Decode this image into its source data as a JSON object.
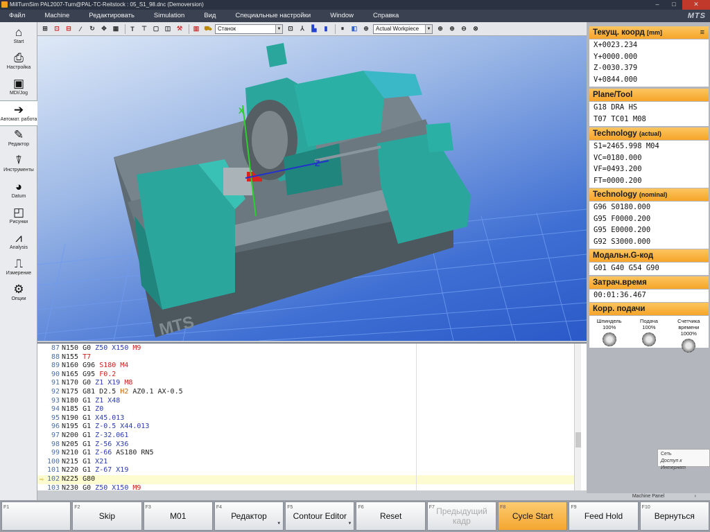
{
  "window": {
    "title": "MillTurnSim PAL2007-Turn@PAL-TC-Reitstock : 05_S1_98.dnc (Demoversion)"
  },
  "menu": {
    "items": [
      "Файл",
      "Machine",
      "Редактировать",
      "Simulation",
      "Вид",
      "Специальные настройки",
      "Window",
      "Справка"
    ],
    "brand": "MTS"
  },
  "sidebar": {
    "items": [
      {
        "label": "Start",
        "icon": "home-icon"
      },
      {
        "label": "Настройка",
        "icon": "setup-icon"
      },
      {
        "label": "MDI/Jog",
        "icon": "mdi-jog-icon"
      },
      {
        "label": "Автомат. работа",
        "icon": "auto-run-icon"
      },
      {
        "label": "Редактор",
        "icon": "editor-icon"
      },
      {
        "label": "Инструменты",
        "icon": "tools-icon"
      },
      {
        "label": "Datum",
        "icon": "datum-icon"
      },
      {
        "label": "Рисунки",
        "icon": "drawings-icon"
      },
      {
        "label": "Analysis",
        "icon": "analysis-icon"
      },
      {
        "label": "Измерение",
        "icon": "measure-icon"
      },
      {
        "label": "Опции",
        "icon": "options-icon"
      }
    ]
  },
  "toolbar": {
    "view_select": "Станок",
    "workpiece_select": "Actual Workpiece"
  },
  "viewport": {
    "watermark": "MTS",
    "axis_x": "X",
    "axis_z": "Z",
    "colors": {
      "machine": "#2aa69c",
      "bed": "#5d6a72",
      "grid": "#5f8ee6",
      "background": "#3f6fd3"
    }
  },
  "editor": {
    "current_line": 102,
    "lines": [
      {
        "n": "87",
        "tokens": [
          [
            "n",
            "N150 G0 "
          ],
          [
            "b",
            "Z50 X150 "
          ],
          [
            "r",
            "M9"
          ]
        ]
      },
      {
        "n": "88",
        "tokens": [
          [
            "n",
            "N155 "
          ],
          [
            "r",
            "T7"
          ]
        ]
      },
      {
        "n": "89",
        "tokens": [
          [
            "n",
            "N160 G96 "
          ],
          [
            "r",
            "S180 M4"
          ]
        ]
      },
      {
        "n": "90",
        "tokens": [
          [
            "n",
            "N165 G95 "
          ],
          [
            "r",
            "F0.2"
          ]
        ]
      },
      {
        "n": "91",
        "tokens": [
          [
            "n",
            "N170 G0 "
          ],
          [
            "b",
            "Z1 X19 "
          ],
          [
            "r",
            "M8"
          ]
        ]
      },
      {
        "n": "92",
        "tokens": [
          [
            "n",
            "N175 G81 D2.5 "
          ],
          [
            "o",
            "H2 "
          ],
          [
            "n",
            "AZ0.1 AX-0.5"
          ]
        ]
      },
      {
        "n": "93",
        "tokens": [
          [
            "n",
            "N180 G1 "
          ],
          [
            "b",
            "Z1 X48"
          ]
        ]
      },
      {
        "n": "94",
        "tokens": [
          [
            "n",
            "N185 G1 "
          ],
          [
            "b",
            "Z0"
          ]
        ]
      },
      {
        "n": "95",
        "tokens": [
          [
            "n",
            "N190 G1 "
          ],
          [
            "b",
            "X45.013"
          ]
        ]
      },
      {
        "n": "96",
        "tokens": [
          [
            "n",
            "N195 G1 "
          ],
          [
            "b",
            "Z-0.5 X44.013"
          ]
        ]
      },
      {
        "n": "97",
        "tokens": [
          [
            "n",
            "N200 G1 "
          ],
          [
            "b",
            "Z-32.061"
          ]
        ]
      },
      {
        "n": "98",
        "tokens": [
          [
            "n",
            "N205 G1 "
          ],
          [
            "b",
            "Z-56 X36"
          ]
        ]
      },
      {
        "n": "99",
        "tokens": [
          [
            "n",
            "N210 G1 "
          ],
          [
            "b",
            "Z-66 "
          ],
          [
            "n",
            "AS180 RN5"
          ]
        ]
      },
      {
        "n": "100",
        "tokens": [
          [
            "n",
            "N215 G1 "
          ],
          [
            "b",
            "X21"
          ]
        ]
      },
      {
        "n": "101",
        "tokens": [
          [
            "n",
            "N220 G1 "
          ],
          [
            "b",
            "Z-67 X19"
          ]
        ]
      },
      {
        "n": "102",
        "tokens": [
          [
            "n",
            "N225 G80"
          ]
        ]
      },
      {
        "n": "103",
        "tokens": [
          [
            "n",
            "N230 G0 "
          ],
          [
            "b",
            "Z50 X150 "
          ],
          [
            "r",
            "M9"
          ]
        ]
      }
    ]
  },
  "right_panel": {
    "coords": {
      "title": "Текущ. коорд",
      "unit": "[mm]",
      "lines": [
        "X+0023.234",
        "Y+0000.000",
        "Z-0030.379",
        "V+0844.000"
      ]
    },
    "plane_tool": {
      "title": "Plane/Tool",
      "lines": [
        "G18 DRA HS",
        "T07 TC01 M08"
      ]
    },
    "tech_actual": {
      "title": "Technology",
      "sub": "(actual)",
      "lines": [
        "S1=2465.998 M04",
        "VC=0180.000",
        "VF=0493.200",
        "FT=0000.200"
      ]
    },
    "tech_nominal": {
      "title": "Technology",
      "sub": "(nominal)",
      "lines": [
        "G96 S0180.000",
        "G95 F0000.200",
        "G95 E0000.200",
        "G92 S3000.000"
      ]
    },
    "modal": {
      "title": "Модальн.G-код",
      "lines": [
        "G01 G40 G54 G90"
      ]
    },
    "time": {
      "title": "Затрач.время",
      "lines": [
        "00:01:36.467"
      ]
    },
    "override": {
      "title": "Корр. подачи",
      "knobs": [
        {
          "label": "Шпиндель",
          "value": "100%"
        },
        {
          "label": "Подача",
          "value": "100%"
        },
        {
          "label": "Счетчика времени",
          "value": "1000%"
        }
      ]
    },
    "machine_panel": "Machine Panel",
    "net_popup": {
      "line1": "Сеть",
      "line2": "Доступ к Интернет"
    }
  },
  "fkeys": [
    {
      "num": "F1",
      "label": "",
      "state": "normal"
    },
    {
      "num": "F2",
      "label": "Skip",
      "state": "normal"
    },
    {
      "num": "F3",
      "label": "M01",
      "state": "normal"
    },
    {
      "num": "F4",
      "label": "Редактор",
      "state": "normal",
      "dropdown": true
    },
    {
      "num": "F5",
      "label": "Contour Editor",
      "state": "normal",
      "dropdown": true
    },
    {
      "num": "F6",
      "label": "Reset",
      "state": "normal"
    },
    {
      "num": "F7",
      "label": "Предыдущий кадр",
      "state": "disabled"
    },
    {
      "num": "F8",
      "label": "Cycle Start",
      "state": "highlight"
    },
    {
      "num": "F9",
      "label": "Feed Hold",
      "state": "normal"
    },
    {
      "num": "F10",
      "label": "Вернуться",
      "state": "normal"
    }
  ]
}
